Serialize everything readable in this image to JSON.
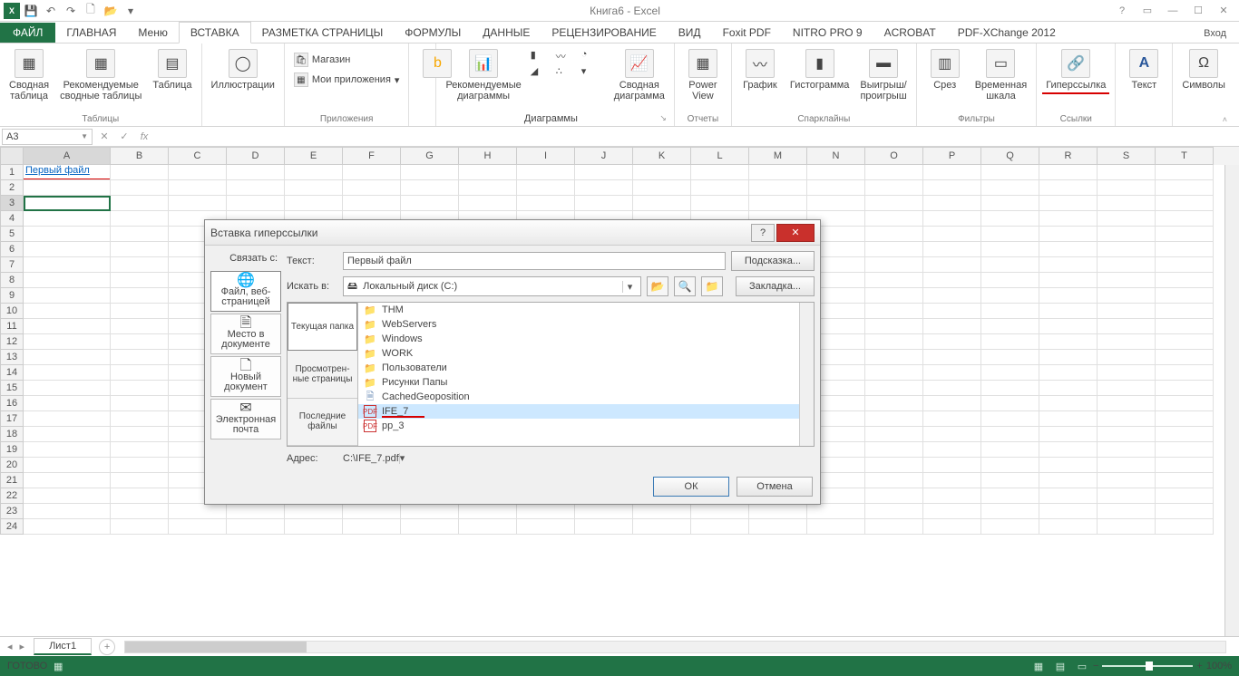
{
  "title": "Книга6 - Excel",
  "qat": {
    "save": "💾",
    "undo": "↶",
    "redo": "↷",
    "new": "🗋",
    "open": "📂"
  },
  "tabs": {
    "file": "ФАЙЛ",
    "home": "ГЛАВНАЯ",
    "menu": "Меню",
    "insert": "ВСТАВКА",
    "layout": "РАЗМЕТКА СТРАНИЦЫ",
    "formulas": "ФОРМУЛЫ",
    "data": "ДАННЫЕ",
    "review": "РЕЦЕНЗИРОВАНИЕ",
    "view": "ВИД",
    "foxit": "Foxit PDF",
    "nitro": "NITRO PRO 9",
    "acrobat": "ACROBAT",
    "pdfx": "PDF-XChange 2012",
    "signin": "Вход"
  },
  "ribbon": {
    "tables": {
      "pivot": "Сводная\nтаблица",
      "rec": "Рекомендуемые\nсводные таблицы",
      "table": "Таблица",
      "label": "Таблицы"
    },
    "illus": {
      "btn": "Иллюстрации"
    },
    "apps": {
      "store": "Магазин",
      "my": "Мои приложения",
      "label": "Приложения"
    },
    "charts": {
      "rec": "Рекомендуемые\nдиаграммы",
      "pivotc": "Сводная\nдиаграмма",
      "label": "Диаграммы"
    },
    "reports": {
      "power": "Power\nView",
      "label": "Отчеты"
    },
    "spark": {
      "line": "График",
      "col": "Гистограмма",
      "winloss": "Выигрыш/\nпроигрыш",
      "label": "Спарклайны"
    },
    "filters": {
      "slicer": "Срез",
      "timeline": "Временная\nшкала",
      "label": "Фильтры"
    },
    "links": {
      "hyper": "Гиперссылка",
      "label": "Ссылки"
    },
    "text": {
      "btn": "Текст"
    },
    "sym": {
      "btn": "Символы"
    }
  },
  "namebox": "A3",
  "cellA1": "Первый файл",
  "columns": [
    "A",
    "B",
    "C",
    "D",
    "E",
    "F",
    "G",
    "H",
    "I",
    "J",
    "K",
    "L",
    "M",
    "N",
    "O",
    "P",
    "Q",
    "R",
    "S",
    "T"
  ],
  "rows": [
    1,
    2,
    3,
    4,
    5,
    6,
    7,
    8,
    9,
    10,
    11,
    12,
    13,
    14,
    15,
    16,
    17,
    18,
    19,
    20,
    21,
    22,
    23,
    24
  ],
  "sheet": "Лист1",
  "status": {
    "ready": "ГОТОВО",
    "zoom": "100%"
  },
  "dialog": {
    "title": "Вставка гиперссылки",
    "linkwith": "Связать с:",
    "textlbl": "Текст:",
    "text": "Первый файл",
    "hint": "Подсказка...",
    "lookin": "Искать в:",
    "drive": "Локальный диск (C:)",
    "bmark": "Закладка...",
    "left": {
      "file": "Файл, веб-\nстраницей",
      "place": "Место в\nдокументе",
      "new": "Новый\nдокумент",
      "mail": "Электронная\nпочта"
    },
    "browse": {
      "cur": "Текущая\nпапка",
      "viewed": "Просмотрен-\nные\nстраницы",
      "recent": "Последние\nфайлы"
    },
    "items": [
      {
        "t": "folder",
        "n": "THM"
      },
      {
        "t": "folder",
        "n": "WebServers"
      },
      {
        "t": "folder",
        "n": "Windows"
      },
      {
        "t": "folder",
        "n": "WORK"
      },
      {
        "t": "folder",
        "n": "Пользователи"
      },
      {
        "t": "folder",
        "n": "Рисунки Папы"
      },
      {
        "t": "file",
        "n": "CachedGeoposition"
      },
      {
        "t": "pdf",
        "n": "IFE_7",
        "sel": true
      },
      {
        "t": "pdf",
        "n": "pp_3"
      }
    ],
    "addrlbl": "Адрес:",
    "addr": "C:\\IFE_7.pdf",
    "ok": "ОК",
    "cancel": "Отмена"
  }
}
